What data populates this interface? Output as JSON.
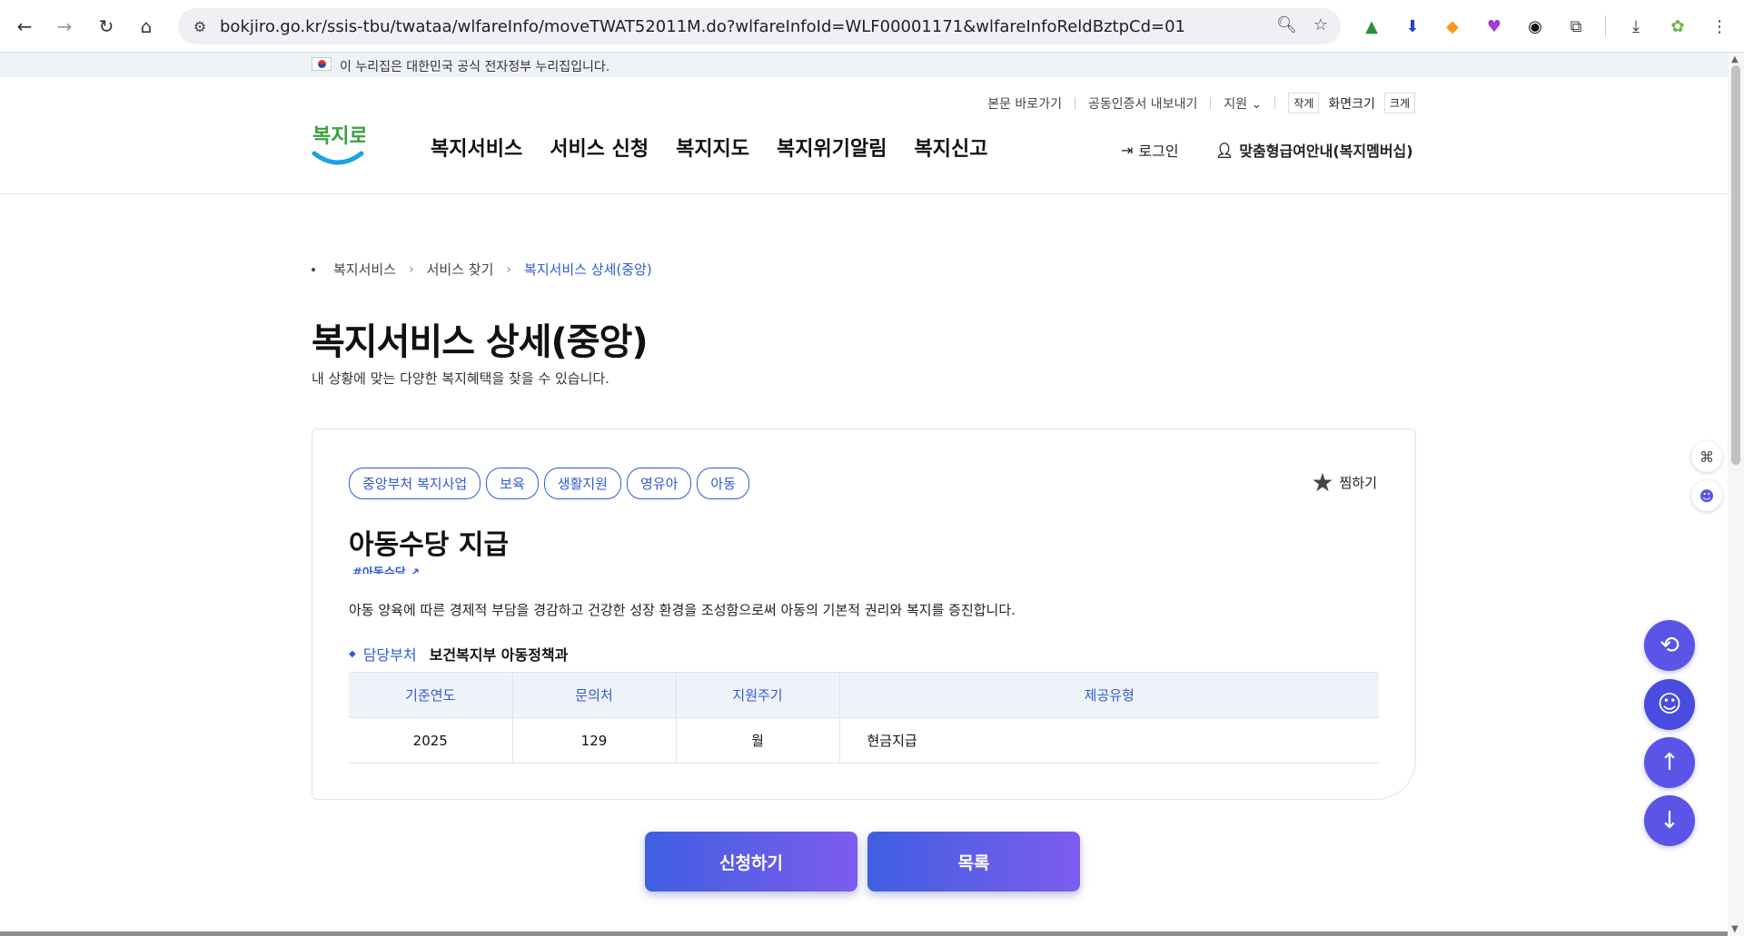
{
  "browser": {
    "url": "bokjiro.go.kr/ssis-tbu/twataa/wlfareInfo/moveTWAT52011M.do?wlfareInfoId=WLF00001171&wlfareInfoReldBztpCd=01"
  },
  "gov_banner": "이 누리집은 대한민국 공식 전자정부 누리집입니다.",
  "util": {
    "skip": "본문 바로가기",
    "cert": "공동인증서 내보내기",
    "support": "지원",
    "small": "작게",
    "screen_size": "화면크기",
    "large": "크게"
  },
  "logo_text": "복지로",
  "gnb": [
    "복지서비스",
    "서비스 신청",
    "복지지도",
    "복지위기알림",
    "복지신고"
  ],
  "login": "로그인",
  "member": "맞춤형급여안내(복지멤버십)",
  "breadcrumb": [
    "복지서비스",
    "서비스 찾기",
    "복지서비스 상세(중앙)"
  ],
  "page_title": "복지서비스 상세(중앙)",
  "page_sub": "내 상황에 맞는 다양한 복지혜택을 찾을 수 있습니다.",
  "card": {
    "tags": [
      "중앙부처 복지사업",
      "보육",
      "생활지원",
      "영유아",
      "아동"
    ],
    "fav": "찜하기",
    "title": "아동수당 지급",
    "hashtag": "#아동수당",
    "desc": "아동 양육에 따른 경제적 부담을 경감하고 건강한 성장 환경을 조성함으로써 아동의 기본적 권리와 복지를 증진합니다.",
    "dept_label": "담당부처",
    "dept_value": "보건복지부 아동정책과",
    "table": {
      "headers": [
        "기준연도",
        "문의처",
        "지원주기",
        "제공유형"
      ],
      "row": [
        "2025",
        "129",
        "월",
        "현금지급"
      ]
    }
  },
  "buttons": {
    "apply": "신청하기",
    "list": "목록"
  },
  "colors": {
    "accent": "#2f5bd3",
    "fab": "#5a55e6"
  }
}
